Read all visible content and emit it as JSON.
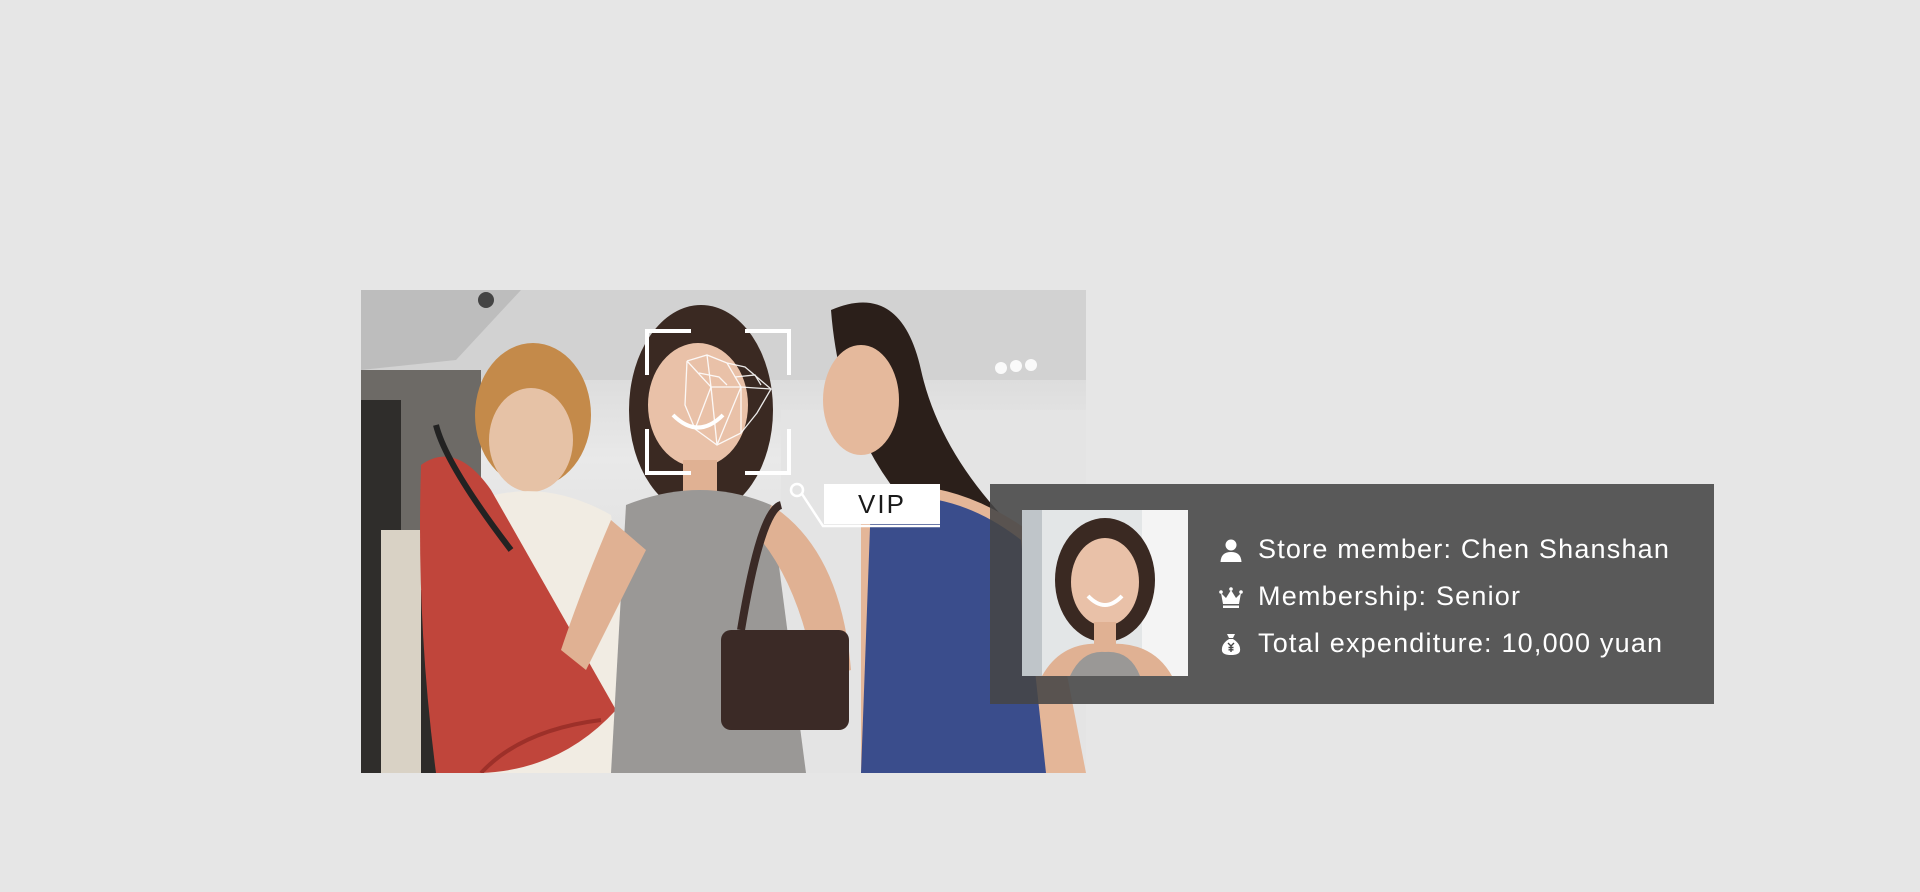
{
  "scene": {
    "vip_tag": "VIP"
  },
  "member_card": {
    "rows": [
      {
        "icon": "person-icon",
        "text": "Store member: Chen Shanshan"
      },
      {
        "icon": "crown-icon",
        "text": "Membership: Senior"
      },
      {
        "icon": "money-bag-icon",
        "text": "Total expenditure: 10,000 yuan"
      }
    ]
  },
  "colors": {
    "background": "#e6e6e6",
    "panel": "#464646",
    "panel_text": "#ffffff",
    "dress_red": "#c0453b",
    "top_blue": "#3a4d8c"
  }
}
